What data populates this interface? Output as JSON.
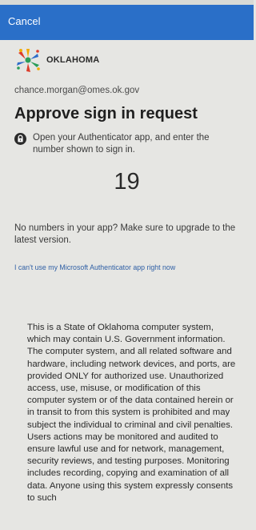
{
  "header": {
    "cancel_label": "Cancel"
  },
  "brand": {
    "name": "OKLAHOMA",
    "logo_icon": "oklahoma-star-logo",
    "colors": [
      "#2d6cc9",
      "#f2a900",
      "#dc3d2b",
      "#2a9d59"
    ]
  },
  "account": {
    "email": "chance.morgan@omes.ok.gov"
  },
  "approval": {
    "title": "Approve sign in request",
    "instruction": "Open your Authenticator app, and enter the number shown to sign in.",
    "instruction_icon": "lock-icon",
    "number": "19",
    "help_text": "No numbers in your app? Make sure to upgrade to the latest version.",
    "alternate_link": "I can't use my Microsoft Authenticator app right now"
  },
  "legal_notice": {
    "text": "This is a State of Oklahoma computer system, which may contain U.S. Government information. The computer system, and all related software and hardware, including network devices, and ports, are provided ONLY for authorized use. Unauthorized access, use, misuse, or modification of this computer system or of the data contained herein or in transit to from this system is prohibited and may subject the individual to criminal and civil penalties. Users actions may be monitored and audited to ensure lawful use and for network, management, security reviews, and testing purposes. Monitoring includes recording, copying and examination of all data. Anyone using this system expressly consents to such"
  },
  "theme": {
    "header_color": "#2a6fc8",
    "link_color": "#2f5fa5",
    "background_color": "#e6e6e3"
  }
}
